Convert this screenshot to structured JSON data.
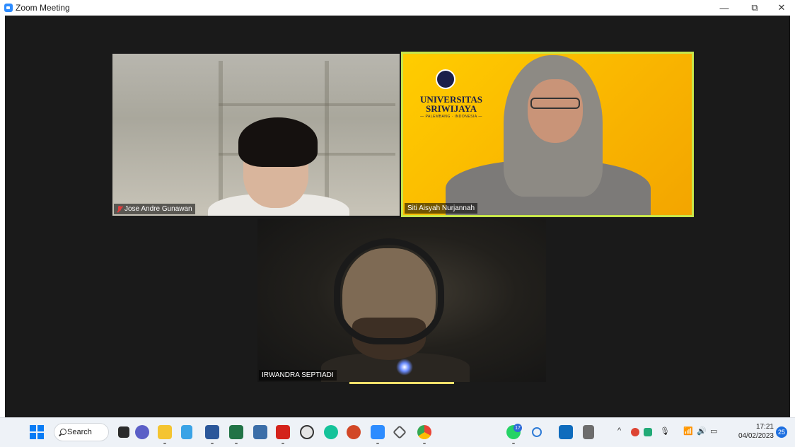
{
  "window": {
    "title": "Zoom Meeting",
    "min_glyph": "—",
    "max_glyph": "⧉",
    "close_glyph": "✕"
  },
  "participants": [
    {
      "name": "Jose Andre Gunawan",
      "muted": true
    },
    {
      "name": "Siti Aisyah Nurjannah",
      "muted": false,
      "background_text": {
        "line1": "UNIVERSITAS",
        "line2": "SRIWIJAYA",
        "sub": "— PALEMBANG · INDONESIA —"
      }
    },
    {
      "name": "IRWANDRA SEPTIADI",
      "muted": false,
      "active_speaker": true
    }
  ],
  "taskbar": {
    "search_label": "Search",
    "apps": [
      "task-view-icon",
      "teams-chat-icon",
      "file-explorer-icon",
      "notepad-icon",
      "word-icon",
      "excel-icon",
      "photos-icon",
      "acrobat-icon",
      "paint-icon",
      "grammarly-icon",
      "powerpoint-icon",
      "zoom-icon",
      "pen-icon",
      "chrome-icon",
      "whatsapp-icon",
      "snipping-icon",
      "outlook-icon",
      "settings-icon"
    ],
    "whatsapp_badge": "17",
    "clock_time": "17:21",
    "clock_date": "04/02/2023",
    "notification_count": "25"
  },
  "colors": {
    "zoom_blue": "#2D8CFF",
    "active_speaker": "#c7e64a",
    "windows_blue": "#0a7cf5"
  }
}
